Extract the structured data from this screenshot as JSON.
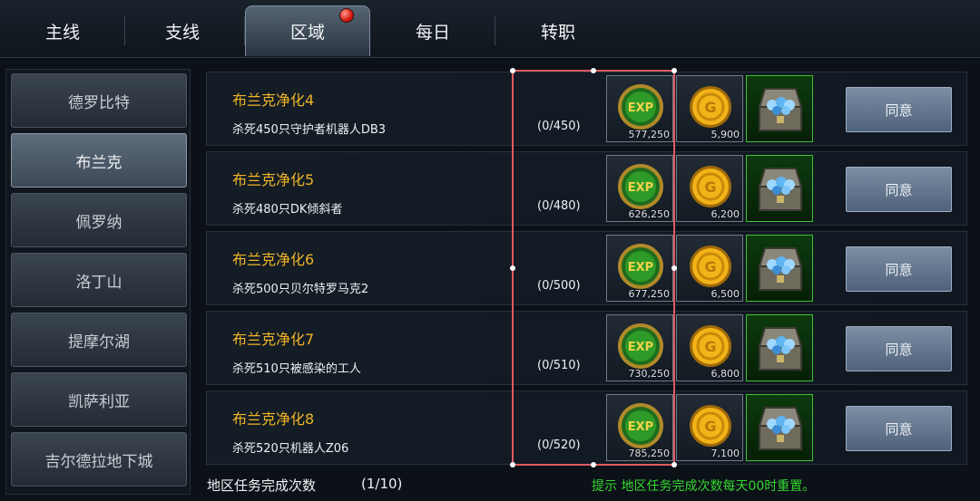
{
  "tabs": [
    {
      "label": "主线",
      "active": false
    },
    {
      "label": "支线",
      "active": false
    },
    {
      "label": "区域",
      "active": true,
      "has_notification": true
    },
    {
      "label": "每日",
      "active": false
    },
    {
      "label": "转职",
      "active": false
    }
  ],
  "sidebar": {
    "items": [
      {
        "label": "德罗比特",
        "active": false
      },
      {
        "label": "布兰克",
        "active": true
      },
      {
        "label": "佩罗纳",
        "active": false
      },
      {
        "label": "洛丁山",
        "active": false
      },
      {
        "label": "提摩尔湖",
        "active": false
      },
      {
        "label": "凯萨利亚",
        "active": false
      },
      {
        "label": "吉尔德拉地下城",
        "active": false
      }
    ]
  },
  "quests": [
    {
      "title": "布兰克净化4",
      "desc": "杀死450只守护者机器人DB3",
      "progress": "(0/450)",
      "exp": "577,250",
      "gold": "5,900",
      "agree_label": "同意"
    },
    {
      "title": "布兰克净化5",
      "desc": "杀死480只DK倾斜者",
      "progress": "(0/480)",
      "exp": "626,250",
      "gold": "6,200",
      "agree_label": "同意"
    },
    {
      "title": "布兰克净化6",
      "desc": "杀死500只贝尔特罗马克2",
      "progress": "(0/500)",
      "exp": "677,250",
      "gold": "6,500",
      "agree_label": "同意"
    },
    {
      "title": "布兰克净化7",
      "desc": "杀死510只被感染的工人",
      "progress": "(0/510)",
      "exp": "730,250",
      "gold": "6,800",
      "agree_label": "同意"
    },
    {
      "title": "布兰克净化8",
      "desc": "杀死520只机器人Z06",
      "progress": "(0/520)",
      "exp": "785,250",
      "gold": "7,100",
      "agree_label": "同意"
    }
  ],
  "reward_icons": {
    "exp": "exp-orb-icon",
    "gold": "gold-coin-icon",
    "chest": "treasure-chest-icon"
  },
  "footer": {
    "label": "地区任务完成次数",
    "count": "(1/10)",
    "tip": "提示 地区任务完成次数每天00时重置。"
  },
  "colors": {
    "quest_title": "#f0b526",
    "tip": "#34d82e",
    "selection": "#e05a60",
    "chest_border": "#3fc034",
    "notification": "#d4160c"
  }
}
